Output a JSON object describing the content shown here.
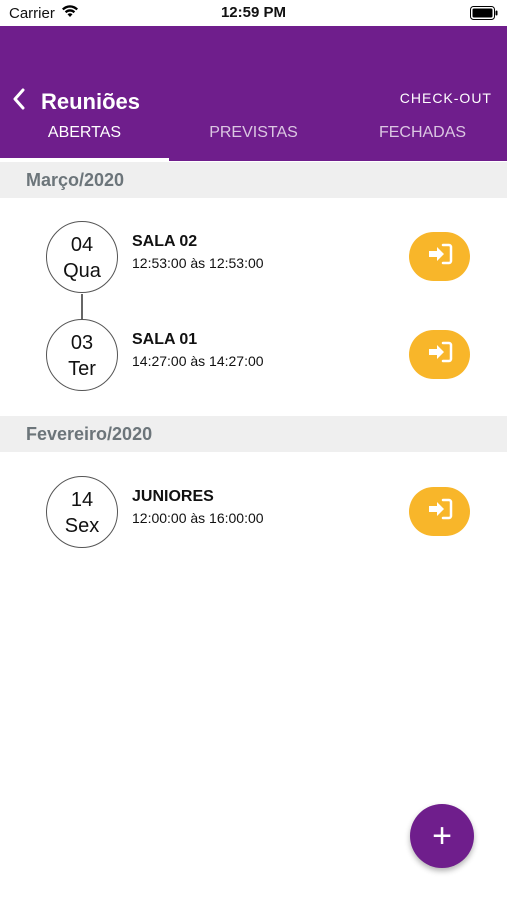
{
  "status_bar": {
    "carrier": "Carrier",
    "time": "12:59 PM"
  },
  "header": {
    "title": "Reuniões",
    "action": "CHECK-OUT",
    "tabs": [
      {
        "label": "ABERTAS",
        "active": true
      },
      {
        "label": "PREVISTAS",
        "active": false
      },
      {
        "label": "FECHADAS",
        "active": false
      }
    ]
  },
  "sections": [
    {
      "title": "Março/2020",
      "items": [
        {
          "day": "04",
          "weekday": "Qua",
          "name": "SALA 02",
          "time": "12:53:00 às 12:53:00"
        },
        {
          "day": "03",
          "weekday": "Ter",
          "name": "SALA 01",
          "time": "14:27:00 às 14:27:00"
        }
      ]
    },
    {
      "title": "Fevereiro/2020",
      "items": [
        {
          "day": "14",
          "weekday": "Sex",
          "name": "JUNIORES",
          "time": "12:00:00 às 16:00:00"
        }
      ]
    }
  ],
  "fab": {
    "label": "+"
  },
  "colors": {
    "primary": "#6f1e8c",
    "accent": "#f8b62a",
    "section_bg": "#efefef"
  }
}
